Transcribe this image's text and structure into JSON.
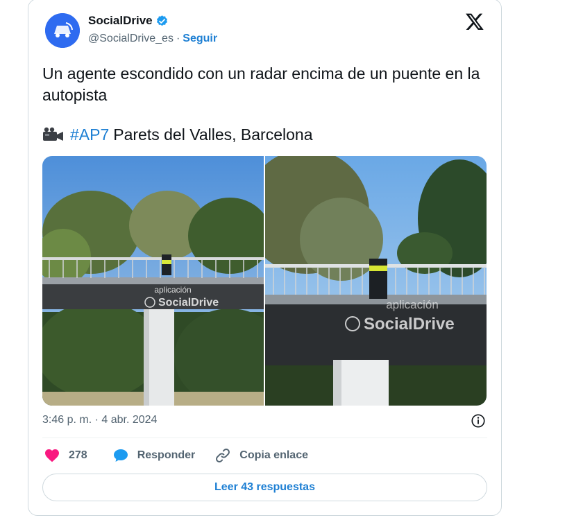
{
  "author": {
    "display_name": "SocialDrive",
    "handle": "@SocialDrive_es",
    "separator": "·",
    "follow_label": "Seguir"
  },
  "tweet": {
    "text": "Un agente escondido con un radar encima de un puente en la autopista",
    "hashtag": "#AP7",
    "location": "Parets del Valles, Barcelona",
    "timestamp": "3:46 p. m. · 4 abr. 2024"
  },
  "media": {
    "photo_1": {
      "watermark_line1": "aplicación",
      "watermark_line2": "SocialDrive"
    },
    "photo_2": {
      "watermark_line1": "aplicación",
      "watermark_line2": "SocialDrive"
    }
  },
  "actions": {
    "like_count": "278",
    "reply_label": "Responder",
    "copy_label": "Copia enlace"
  },
  "read_replies_label": "Leer 43 respuestas",
  "colors": {
    "accent": "#1d7fd3",
    "like": "#f91880",
    "verified": "#1d9bf0",
    "border": "#cfd9de",
    "muted": "#536471"
  },
  "icons": [
    "verified-badge-icon",
    "x-logo-icon",
    "camera-icon",
    "info-icon",
    "heart-icon",
    "speech-bubble-icon",
    "link-icon"
  ]
}
